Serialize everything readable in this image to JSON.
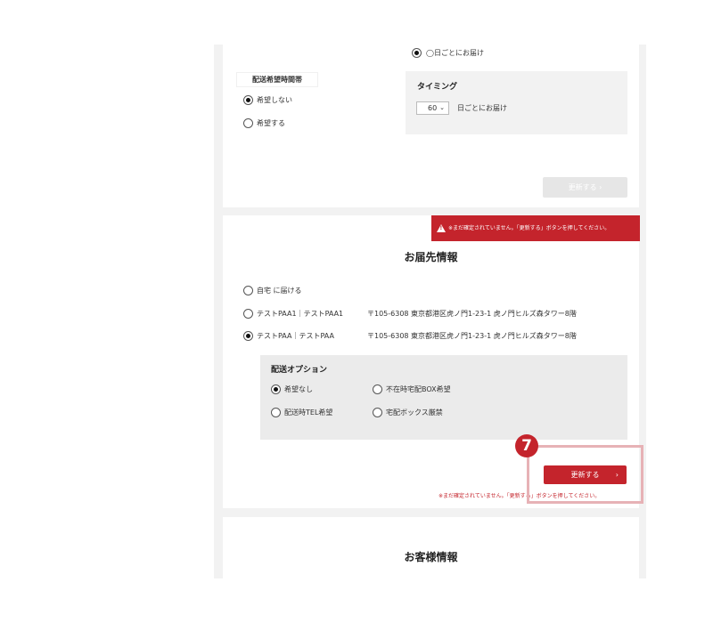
{
  "top_card": {
    "interval_option_label": "◯日ごとにお届け",
    "delivery_time_heading": "配送希望時間帯",
    "time_options": [
      {
        "label": "希望しない",
        "checked": true
      },
      {
        "label": "希望する",
        "checked": false
      }
    ],
    "timing": {
      "heading": "タイミング",
      "selected_value": "60",
      "suffix": "日ごとにお届け"
    },
    "update_label": "更新する ›"
  },
  "address_card": {
    "warning": "※まだ確定されていません。「更新する」ボタンを押してください。",
    "title": "お届先情報",
    "addresses": [
      {
        "name": "自宅 に届ける",
        "address": "",
        "checked": false
      },
      {
        "name": "テストPAA1｜テストPAA1",
        "address": "〒105-6308 東京都港区虎ノ門1-23-1 虎ノ門ヒルズ森タワー8階",
        "checked": false
      },
      {
        "name": "テストPAA｜テストPAA",
        "address": "〒105-6308 東京都港区虎ノ門1-23-1 虎ノ門ヒルズ森タワー8階",
        "checked": true
      }
    ],
    "options": {
      "heading": "配送オプション",
      "items": [
        {
          "label": "希望なし",
          "checked": true
        },
        {
          "label": "不在時宅配BOX希望",
          "checked": false
        },
        {
          "label": "配送時TEL希望",
          "checked": false
        },
        {
          "label": "宅配ボックス厳禁",
          "checked": false
        }
      ]
    },
    "step_number": "7",
    "update_label": "更新する",
    "update_arrow": "›",
    "note": "※まだ確定されていません。「更新する」ボタンを押してください。"
  },
  "customer_card": {
    "title": "お客様情報"
  }
}
